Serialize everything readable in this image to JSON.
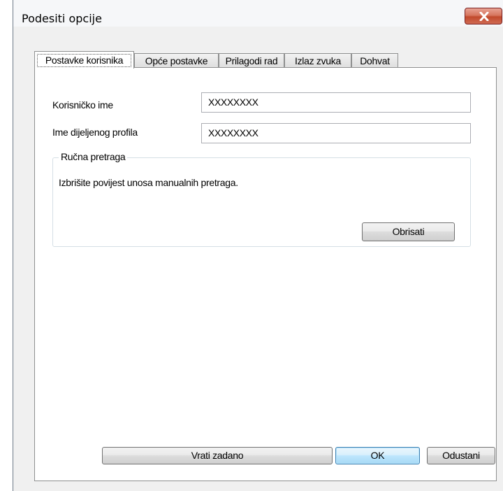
{
  "window": {
    "title": "Podesiti opcije"
  },
  "tabs": [
    {
      "label": "Postavke korisnika",
      "active": true
    },
    {
      "label": "Opće postavke",
      "active": false
    },
    {
      "label": "Prilagodi rad",
      "active": false
    },
    {
      "label": "Izlaz zvuka",
      "active": false
    },
    {
      "label": "Dohvat",
      "active": false
    }
  ],
  "user_settings": {
    "username_label": "Korisničko ime",
    "username_value": "XXXXXXXX",
    "shared_profile_label": "Ime dijeljenog profila",
    "shared_profile_value": "XXXXXXXX"
  },
  "manual_search": {
    "group_title": "Ručna pretraga",
    "description": "Izbrišite povijest unosa manualnih pretraga.",
    "delete_label": "Obrisati"
  },
  "footer": {
    "reset_label": "Vrati zadano",
    "ok_label": "OK",
    "cancel_label": "Odustani"
  },
  "colors": {
    "close_button": "#c14a2d",
    "default_button_border": "#3c7fb1"
  },
  "icons": {
    "close": "close-icon"
  }
}
